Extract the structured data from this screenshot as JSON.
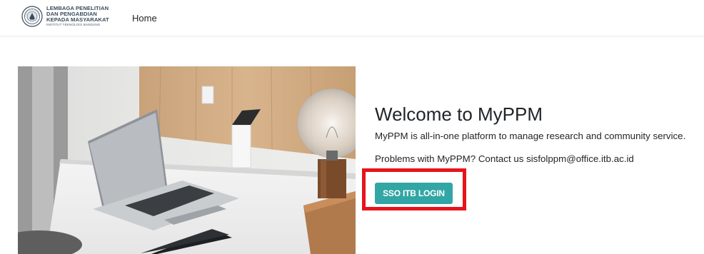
{
  "header": {
    "logo_lines": [
      "LEMBAGA PENELITIAN",
      "DAN PENGABDIAN",
      "KEPADA MASYARAKAT"
    ],
    "logo_subline": "INSTITUT TEKNOLOGI BANDUNG",
    "nav_home": "Home"
  },
  "main": {
    "title": "Welcome to MyPPM",
    "description": "MyPPM is all-in-one platform to manage research and community service.",
    "contact": "Problems with MyPPM? Contact us sisfolppm@office.itb.ac.id",
    "login_button": "SSO ITB LOGIN"
  },
  "colors": {
    "button": "#31a6a4",
    "highlight": "#e8131b"
  },
  "icons": {
    "logo": "institution-seal-icon",
    "hero": "desk-workspace-photo"
  }
}
